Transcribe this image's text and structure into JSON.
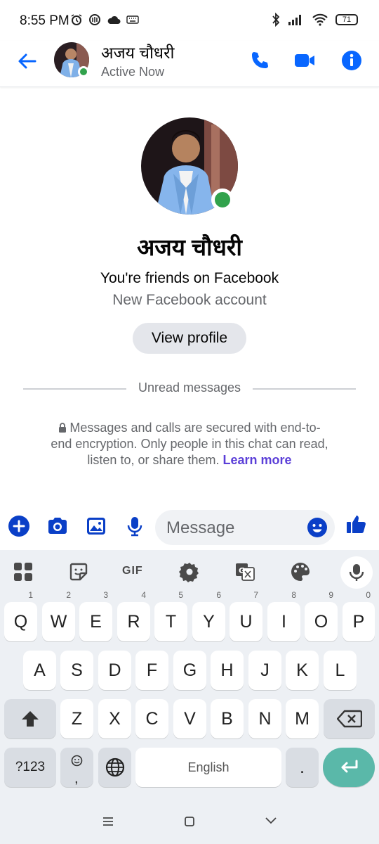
{
  "status_bar": {
    "time": "8:55 PM",
    "battery": "71"
  },
  "header": {
    "name": "अजय चौधरी",
    "status": "Active Now"
  },
  "profile": {
    "name": "अजय चौधरी",
    "friends_text": "You're friends on Facebook",
    "account_text": "New Facebook account",
    "view_profile_label": "View profile"
  },
  "unread_label": "Unread messages",
  "encryption": {
    "text": "Messages and calls are secured with end-to-end encryption. Only people in this chat can read, listen to, or share them.",
    "link": "Learn more"
  },
  "composer": {
    "placeholder": "Message"
  },
  "keyboard": {
    "gif_label": "GIF",
    "row1": [
      "Q",
      "W",
      "E",
      "R",
      "T",
      "Y",
      "U",
      "I",
      "O",
      "P"
    ],
    "row1_nums": [
      "1",
      "2",
      "3",
      "4",
      "5",
      "6",
      "7",
      "8",
      "9",
      "0"
    ],
    "row2": [
      "A",
      "S",
      "D",
      "F",
      "G",
      "H",
      "J",
      "K",
      "L"
    ],
    "row3": [
      "Z",
      "X",
      "C",
      "V",
      "B",
      "N",
      "M"
    ],
    "symbols_label": "?123",
    "comma_label": ",",
    "space_label": "English",
    "period_label": "."
  },
  "colors": {
    "accent": "#0866ff",
    "online": "#31a24c",
    "link": "#5b3fd8",
    "enter": "#5ab8a9"
  }
}
